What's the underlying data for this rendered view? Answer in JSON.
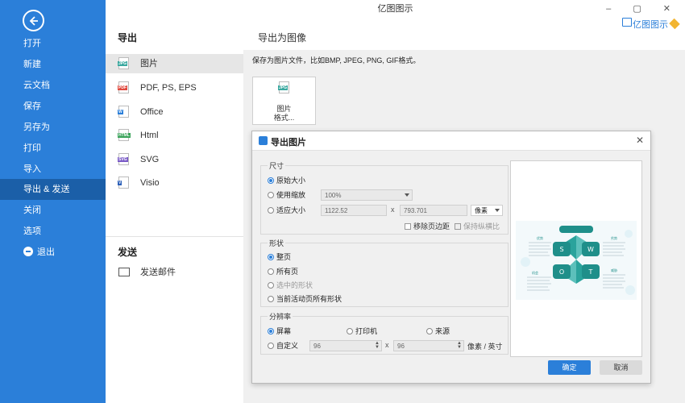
{
  "app_title": "亿图图示",
  "brand": {
    "label": "亿图图示"
  },
  "window_controls": "–  ▢  ✕",
  "sidebar": {
    "items": [
      {
        "label": "打开"
      },
      {
        "label": "新建"
      },
      {
        "label": "云文档"
      },
      {
        "label": "保存"
      },
      {
        "label": "另存为"
      },
      {
        "label": "打印"
      },
      {
        "label": "导入"
      },
      {
        "label": "导出 & 发送"
      },
      {
        "label": "关闭"
      },
      {
        "label": "选项"
      },
      {
        "label": "退出"
      }
    ]
  },
  "export_panel": {
    "title": "导出",
    "items": [
      {
        "label": "图片",
        "icon": "JPG",
        "color": "#3ba9a0"
      },
      {
        "label": "PDF, PS, EPS",
        "icon": "PDF",
        "color": "#e04a3f"
      },
      {
        "label": "Office",
        "icon": "W",
        "color": "#2b7fd9"
      },
      {
        "label": "Html",
        "icon": "HTML",
        "color": "#3aa35a"
      },
      {
        "label": "SVG",
        "icon": "SVG",
        "color": "#7a5bc7"
      },
      {
        "label": "Visio",
        "icon": "V",
        "color": "#2b5fb8"
      }
    ],
    "send_title": "发送",
    "send_mail_label": "发送邮件"
  },
  "content": {
    "title": "导出为图像",
    "description": "保存为图片文件，比如BMP, JPEG, PNG, GIF格式。",
    "card_line1": "图片",
    "card_line2": "格式..."
  },
  "dialog": {
    "title": "导出图片",
    "size_group": {
      "label": "尺寸",
      "original_size": "原始大小",
      "use_zoom": "使用缩放",
      "zoom_value": "100%",
      "fit_size": "适应大小",
      "width": "1122.52",
      "times": "x",
      "height": "793.701",
      "unit": "像素",
      "remove_margin": "移除页边距",
      "keep_ratio": "保持纵横比"
    },
    "shape_group": {
      "label": "形状",
      "whole_page": "整页",
      "all_pages": "所有页",
      "selected_shapes": "选中的形状",
      "current_page_shapes": "当前活动页所有形状"
    },
    "resolution_group": {
      "label": "分辨率",
      "screen": "屏幕",
      "printer": "打印机",
      "source": "来源",
      "custom": "自定义",
      "dpi_x": "96",
      "times": "x",
      "dpi_y": "96",
      "unit": "像素 / 英寸"
    },
    "preview": {
      "diagram_title": "",
      "letters": [
        "S",
        "W",
        "O",
        "T"
      ],
      "corner_labels": [
        "优势",
        "劣势",
        "机会",
        "威胁"
      ]
    },
    "ok_label": "确定",
    "cancel_label": "取消"
  }
}
